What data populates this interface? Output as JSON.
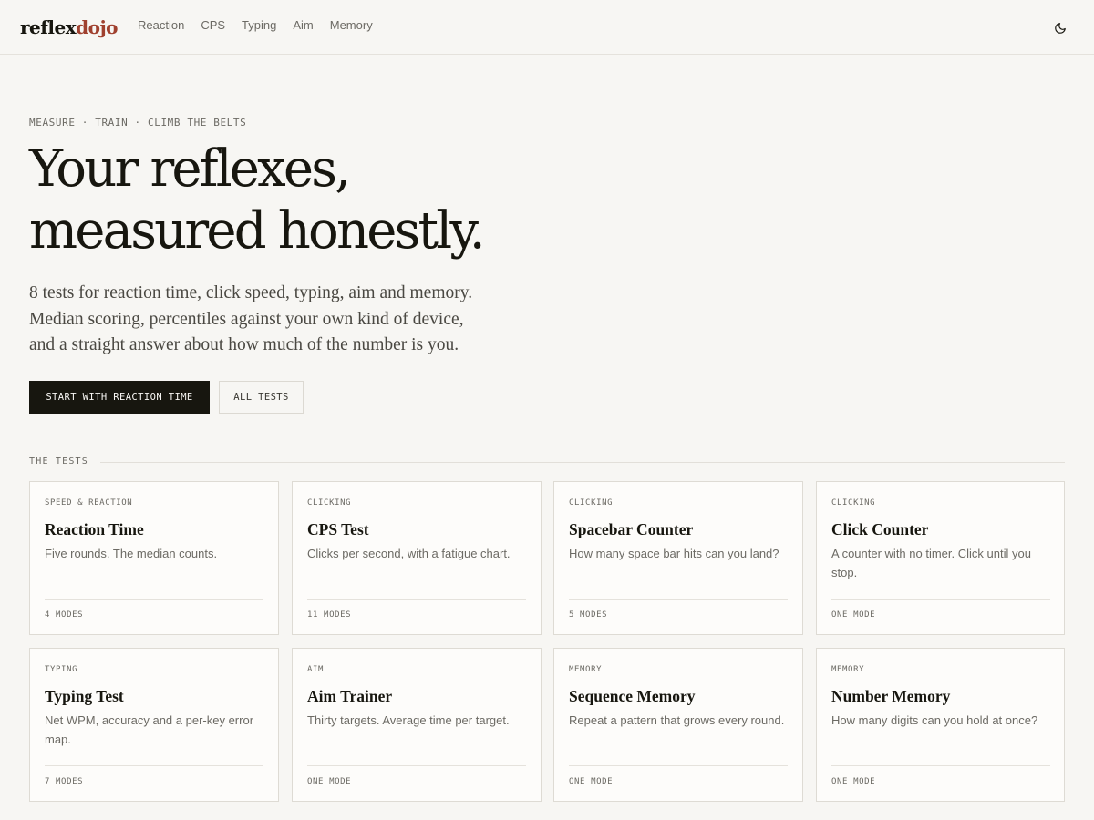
{
  "brand": {
    "part1": "reflex",
    "part2": "dojo",
    "accent_color": "#a0402e"
  },
  "nav": {
    "items": [
      "Reaction",
      "CPS",
      "Typing",
      "Aim",
      "Memory"
    ]
  },
  "theme_toggle": {
    "icon": "moon-icon"
  },
  "hero": {
    "eyebrow": "MEASURE · TRAIN · CLIMB THE BELTS",
    "title_lines": [
      "Your reflexes,",
      "measured honestly."
    ],
    "subtitle_lines": [
      "8 tests for reaction time, click speed, typing, aim and memory.",
      "Median scoring, percentiles against your own kind of device,",
      "and a straight answer about how much of the number is you."
    ],
    "primary_cta": "START WITH REACTION TIME",
    "secondary_cta": "ALL TESTS"
  },
  "tests_section": {
    "label": "THE TESTS",
    "cards": [
      {
        "category": "SPEED & REACTION",
        "title": "Reaction Time",
        "description": "Five rounds. The median counts.",
        "modes": "4 MODES"
      },
      {
        "category": "CLICKING",
        "title": "CPS Test",
        "description": "Clicks per second, with a fatigue chart.",
        "modes": "11 MODES"
      },
      {
        "category": "CLICKING",
        "title": "Spacebar Counter",
        "description": "How many space bar hits can you land?",
        "modes": "5 MODES"
      },
      {
        "category": "CLICKING",
        "title": "Click Counter",
        "description": "A counter with no timer. Click until you stop.",
        "modes": "ONE MODE"
      },
      {
        "category": "TYPING",
        "title": "Typing Test",
        "description": "Net WPM, accuracy and a per-key error map.",
        "modes": "7 MODES"
      },
      {
        "category": "AIM",
        "title": "Aim Trainer",
        "description": "Thirty targets. Average time per target.",
        "modes": "ONE MODE"
      },
      {
        "category": "MEMORY",
        "title": "Sequence Memory",
        "description": "Repeat a pattern that grows every round.",
        "modes": "ONE MODE"
      },
      {
        "category": "MEMORY",
        "title": "Number Memory",
        "description": "How many digits can you hold at once?",
        "modes": "ONE MODE"
      }
    ]
  }
}
